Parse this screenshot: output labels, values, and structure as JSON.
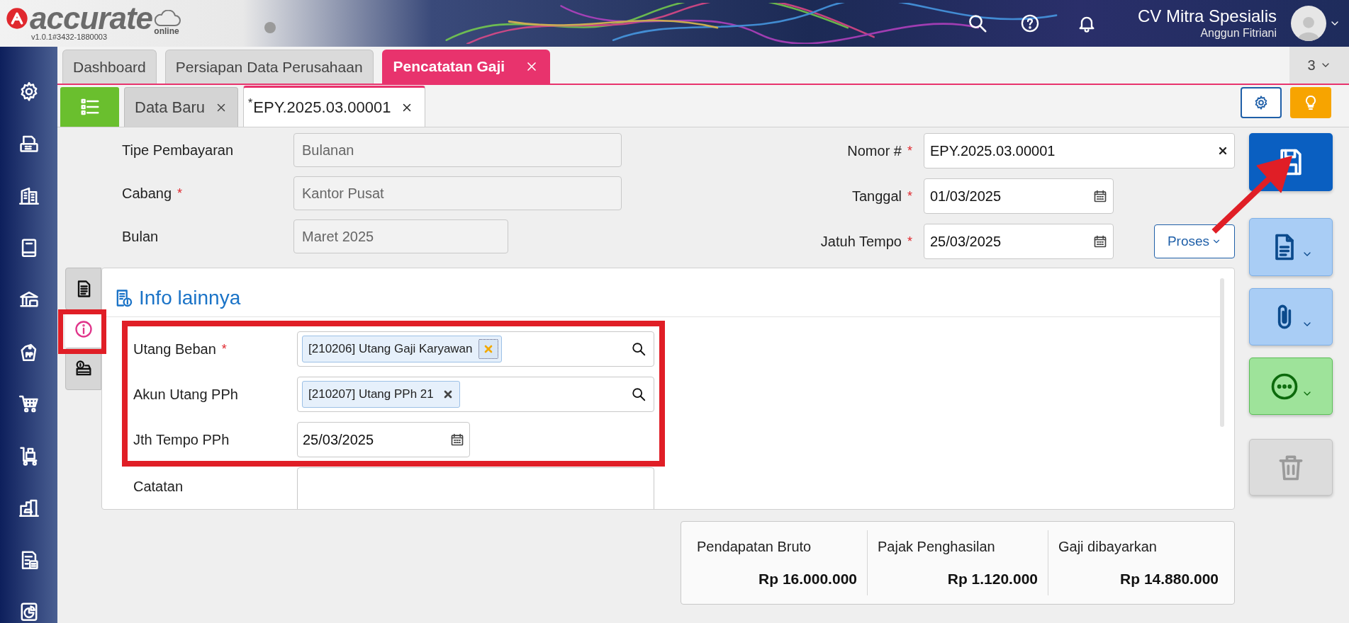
{
  "app": {
    "logo": "accurate",
    "logo_sub": "online",
    "version": "v1.0.1#3432-1880003"
  },
  "account": {
    "company": "CV Mitra Spesialis",
    "user": "Anggun Fitriani"
  },
  "module_tabs": [
    {
      "label": "Dashboard",
      "selected": false
    },
    {
      "label": "Persiapan Data Perusahaan",
      "selected": false
    },
    {
      "label": "Pencatatan Gaji",
      "selected": true
    }
  ],
  "tab_count": "3",
  "doc_tabs": [
    {
      "label": "Data Baru",
      "selected": false
    },
    {
      "label": "EPY.2025.03.00001",
      "prefix": "*",
      "selected": true
    }
  ],
  "form_left": [
    {
      "label": "Tipe Pembayaran",
      "value": "Bulanan",
      "required": false,
      "kind": "text"
    },
    {
      "label": "Cabang",
      "value": "Kantor Pusat",
      "required": true,
      "kind": "text"
    },
    {
      "label": "Bulan",
      "value": "Maret 2025",
      "required": false,
      "kind": "period"
    }
  ],
  "form_right": [
    {
      "label": "Nomor #",
      "value": "EPY.2025.03.00001",
      "required": true,
      "kind": "clearable"
    },
    {
      "label": "Tanggal",
      "value": "01/03/2025",
      "required": true,
      "kind": "date"
    },
    {
      "label": "Jatuh Tempo",
      "value": "25/03/2025",
      "required": true,
      "kind": "date"
    }
  ],
  "process_button": "Proses",
  "side_tabs": [
    {
      "kind": "document",
      "selected": false
    },
    {
      "kind": "info",
      "selected": true
    },
    {
      "kind": "printer",
      "selected": false
    }
  ],
  "info_section": {
    "title": "Info lainnya",
    "fields": [
      {
        "label": "Utang Beban",
        "required": true,
        "kind": "tag",
        "value": "[210206] Utang Gaji Karyawan",
        "focused": true
      },
      {
        "label": "Akun Utang PPh",
        "required": false,
        "kind": "tag",
        "value": "[210207] Utang PPh 21",
        "focused": false
      },
      {
        "label": "Jth Tempo PPh",
        "required": false,
        "kind": "date",
        "value": "25/03/2025"
      },
      {
        "label": "Catatan",
        "required": false,
        "kind": "textarea"
      }
    ]
  },
  "totals": [
    {
      "label": "Pendapatan Bruto",
      "amount": "Rp 16.000.000"
    },
    {
      "label": "Pajak Penghasilan",
      "amount": "Rp 1.120.000"
    },
    {
      "label": "Gaji dibayarkan",
      "amount": "Rp 14.880.000"
    }
  ],
  "action_buttons": [
    {
      "kind": "save",
      "disabled": false
    },
    {
      "kind": "document",
      "disabled": false
    },
    {
      "kind": "attach",
      "disabled": false
    },
    {
      "kind": "more",
      "disabled": false
    },
    {
      "kind": "delete",
      "disabled": true
    }
  ]
}
